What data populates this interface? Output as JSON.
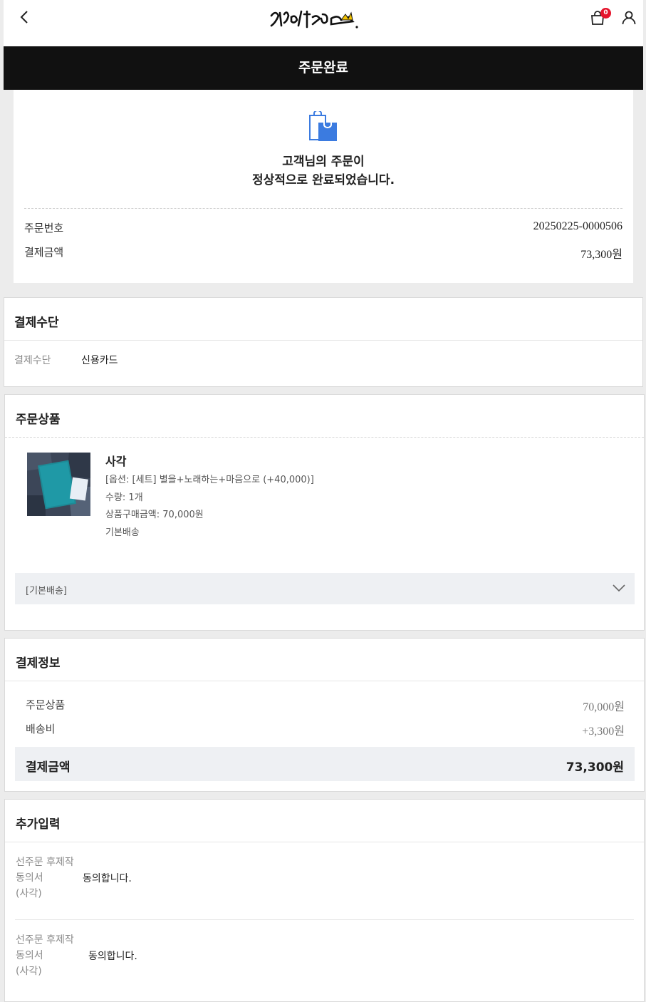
{
  "header": {
    "logo_text": "겸손은 힘들다",
    "cart_count": "0"
  },
  "title": "주문완료",
  "receipt": {
    "message_line1": "고객님의 주문이",
    "message_line2": "정상적으로 완료되었습니다.",
    "order_number_label": "주문번호",
    "order_number": "20250225-0000506",
    "amount_label": "결제금액",
    "amount": "73,300원"
  },
  "payment_method": {
    "title": "결제수단",
    "label": "결제수단",
    "value": "신용카드"
  },
  "order_items": {
    "title": "주문상품",
    "item": {
      "name": "사각",
      "option": "[옵션: [세트] 별을+노래하는+마음으로 (+40,000)]",
      "quantity": "수량: 1개",
      "price": "상품구매금액: 70,000원",
      "shipping": "기본배송"
    },
    "shipping_group": "[기본배송]"
  },
  "payment_info": {
    "title": "결제정보",
    "products_label": "주문상품",
    "products_value": "70,000원",
    "shipping_label": "배송비",
    "shipping_value": "+3,300원",
    "total_label": "결제금액",
    "total_value": "73,300원"
  },
  "extra_input": {
    "title": "추가입력",
    "rows": [
      {
        "label_l1": "선주문 후제작",
        "label_l2": "동의서",
        "label_l3": "(사각)",
        "value": "동의합니다."
      },
      {
        "label_l1": "선주문 후제작",
        "label_l2": "동의서",
        "label_l3": "(사각)",
        "value": "동의합니다."
      }
    ]
  },
  "colors": {
    "title_bar": "#111111",
    "badge": "#e5142b",
    "bag_icon": "#3b7be0"
  }
}
